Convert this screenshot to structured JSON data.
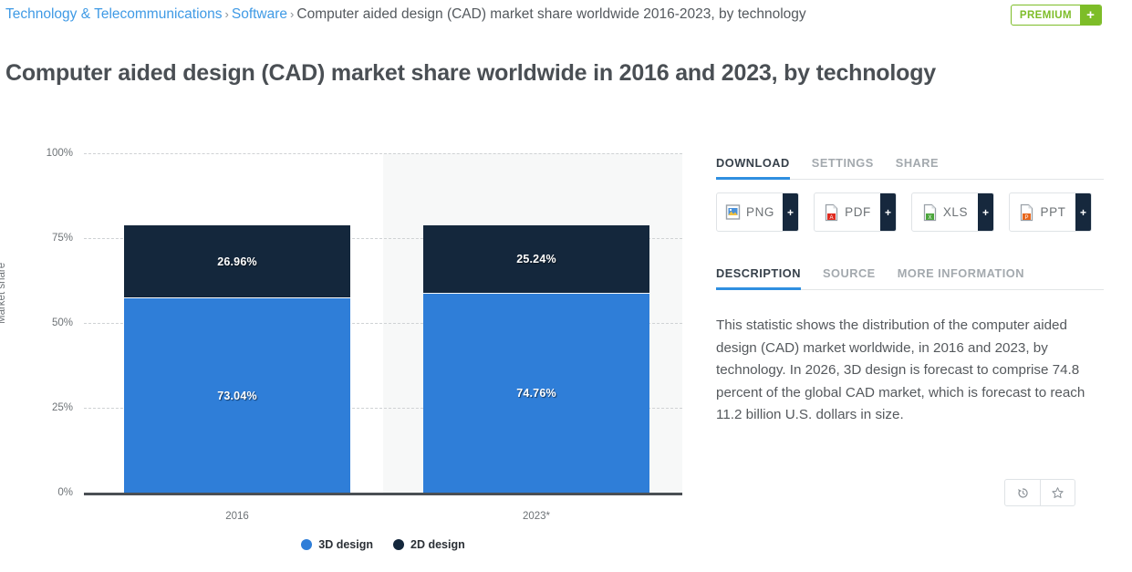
{
  "breadcrumb": {
    "items": [
      {
        "label": "Technology & Telecommunications",
        "link": true
      },
      {
        "label": "Software",
        "link": true
      },
      {
        "label": "Computer aided design (CAD) market share worldwide 2016-2023, by technology",
        "link": false
      }
    ],
    "separator": "›"
  },
  "premium": {
    "label": "PREMIUM",
    "plus": "+"
  },
  "page_title": "Computer aided design (CAD) market share worldwide in 2016 and 2023, by technology",
  "chart_data": {
    "type": "bar",
    "stacked": true,
    "percent": true,
    "title": "",
    "xlabel": "",
    "ylabel": "Market share",
    "categories": [
      "2016",
      "2023*"
    ],
    "ylim": [
      0,
      100
    ],
    "yticks": [
      "0%",
      "25%",
      "50%",
      "75%",
      "100%"
    ],
    "grid": true,
    "legend_position": "bottom",
    "series": [
      {
        "name": "3D design",
        "color": "#2f7ed8",
        "values": [
          73.04,
          74.76
        ],
        "labels": [
          "73.04%",
          "74.76%"
        ]
      },
      {
        "name": "2D design",
        "color": "#14273c",
        "values": [
          26.96,
          25.24
        ],
        "labels": [
          "26.96%",
          "25.24%"
        ]
      }
    ]
  },
  "panel": {
    "download_tabs": [
      {
        "label": "DOWNLOAD",
        "active": true
      },
      {
        "label": "SETTINGS",
        "active": false
      },
      {
        "label": "SHARE",
        "active": false
      }
    ],
    "download_buttons": [
      {
        "name": "PNG",
        "icon": "png-file-icon",
        "plus": "+"
      },
      {
        "name": "PDF",
        "icon": "pdf-file-icon",
        "plus": "+"
      },
      {
        "name": "XLS",
        "icon": "xls-file-icon",
        "plus": "+"
      },
      {
        "name": "PPT",
        "icon": "ppt-file-icon",
        "plus": "+"
      }
    ],
    "info_tabs": [
      {
        "label": "DESCRIPTION",
        "active": true
      },
      {
        "label": "SOURCE",
        "active": false
      },
      {
        "label": "MORE INFORMATION",
        "active": false
      }
    ],
    "description": "This statistic shows the distribution of the computer aided design (CAD) market worldwide, in 2016 and 2023, by technology. In 2026, 3D design is forecast to comprise 74.8 percent of the global CAD market, which is forecast to reach 11.2 billion U.S. dollars in size.",
    "actions": [
      {
        "icon": "history-icon",
        "glyph": "↺"
      },
      {
        "icon": "star-icon",
        "glyph": "☆"
      }
    ]
  }
}
